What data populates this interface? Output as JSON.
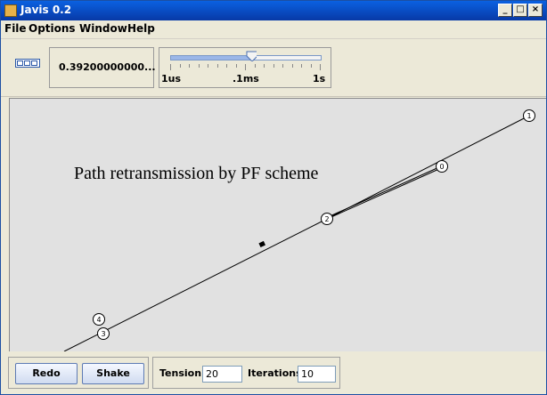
{
  "window": {
    "title": "Javis 0.2"
  },
  "controls": {
    "minimize": "_",
    "maximize": "□",
    "close": "×"
  },
  "menu": [
    {
      "label": "File"
    },
    {
      "label": "Options"
    },
    {
      "label": "Window"
    },
    {
      "label": "Help"
    }
  ],
  "toolbar": {
    "time_display": "0.39200000000...",
    "slider": {
      "level_fraction": 0.55,
      "tick_labels": [
        "1us",
        ".1ms",
        "1s"
      ]
    }
  },
  "canvas": {
    "title": "Path retransmission by PF scheme",
    "nodes": [
      {
        "id": "1",
        "label": "1"
      },
      {
        "id": "0",
        "label": "0"
      },
      {
        "id": "2",
        "label": "2"
      },
      {
        "id": "4",
        "label": "4"
      },
      {
        "id": "3",
        "label": "3"
      }
    ]
  },
  "bottom": {
    "redo_label": "Redo",
    "shake_label": "Shake",
    "tension_label": "Tension",
    "tension_value": "20",
    "iterations_label": "Iterations",
    "iterations_value": "10"
  }
}
